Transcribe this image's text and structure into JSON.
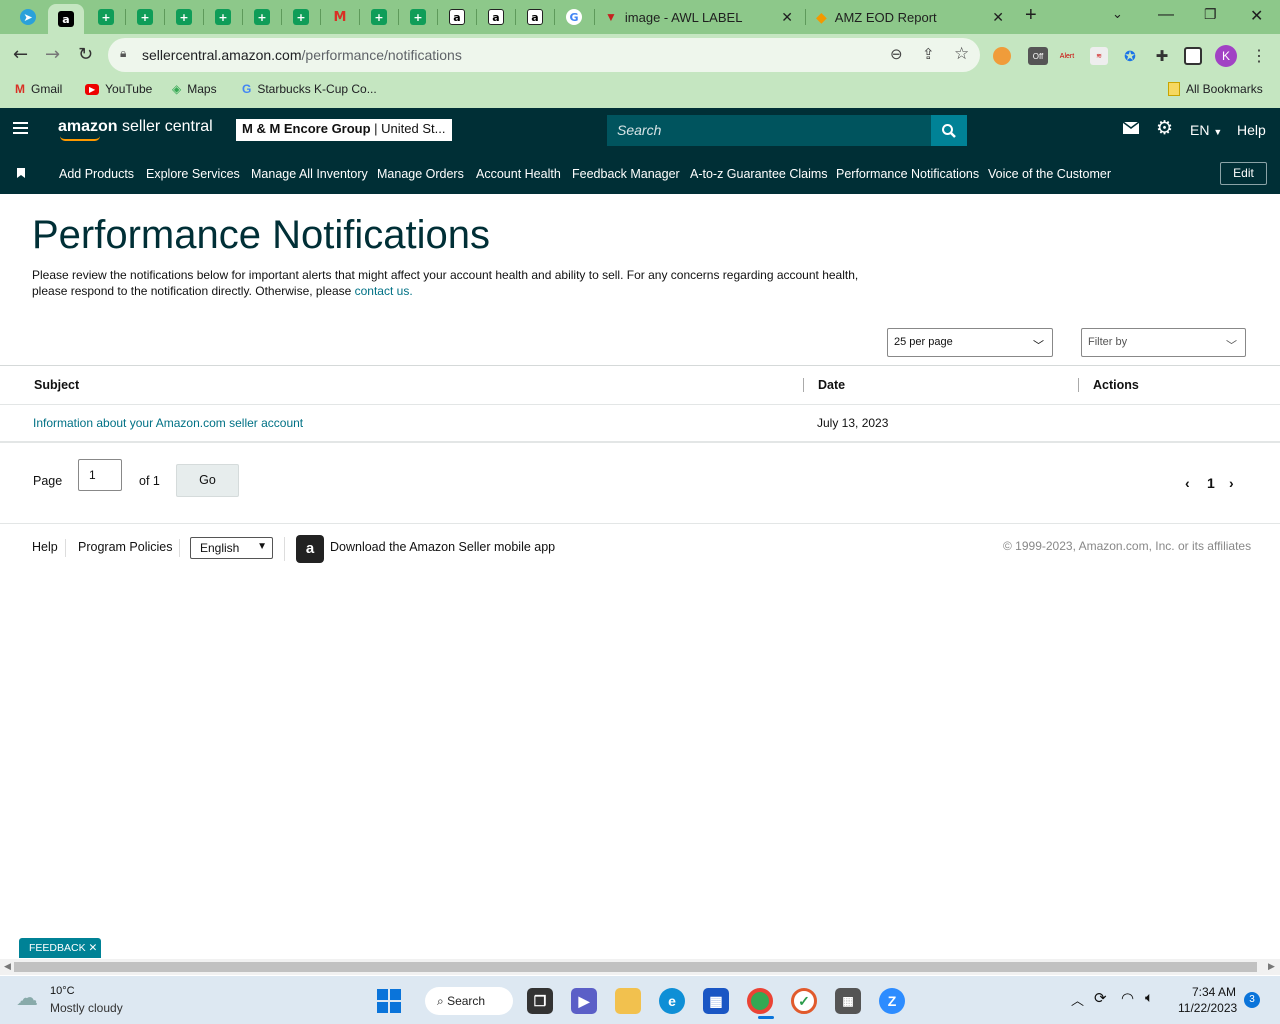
{
  "browser": {
    "tabs": [
      {
        "title": "image - AWL LABEL"
      },
      {
        "title": "AMZ EOD Report"
      }
    ],
    "url_domain": "sellercentral.amazon.com",
    "url_path": "/performance/notifications",
    "profile_initial": "K",
    "bookmarks": [
      {
        "label": "Gmail"
      },
      {
        "label": "YouTube"
      },
      {
        "label": "Maps"
      },
      {
        "label": "Starbucks K-Cup Co..."
      }
    ],
    "all_bookmarks": "All Bookmarks"
  },
  "seller": {
    "logo_prefix": "amazon",
    "logo_suffix": " seller central",
    "account_name": "M & M Encore Group",
    "account_region": " | United St...",
    "search_placeholder": "Search",
    "language": "EN",
    "help": "Help"
  },
  "nav": {
    "items": [
      "Add Products",
      "Explore Services",
      "Manage All Inventory",
      "Manage Orders",
      "Account Health",
      "Feedback Manager",
      "A-to-z Guarantee Claims",
      "Performance Notifications",
      "Voice of the Customer"
    ],
    "edit": "Edit"
  },
  "page": {
    "title": "Performance Notifications",
    "description": "Please review the notifications below for important alerts that might affect your account health and ability to sell. For any concerns regarding account health, please respond to the notification directly. Otherwise, please ",
    "contact_link": "contact us.",
    "per_page": "25 per page",
    "filter_by": "Filter by"
  },
  "table": {
    "headers": [
      "Subject",
      "Date",
      "Actions"
    ],
    "rows": [
      {
        "subject": "Information about your Amazon.com seller account",
        "date": "July 13, 2023",
        "actions": ""
      }
    ]
  },
  "pagination": {
    "page_label": "Page",
    "page_value": "1",
    "of_label": "of 1",
    "go": "Go",
    "current": "1"
  },
  "footer": {
    "help": "Help",
    "policies": "Program Policies",
    "language": "English",
    "app": "Download the Amazon Seller mobile app",
    "copyright": "© 1999-2023, Amazon.com, Inc. or its affiliates"
  },
  "feedback": "FEEDBACK",
  "taskbar": {
    "temp": "10°C",
    "weather": "Mostly cloudy",
    "search": "Search",
    "time": "7:34 AM",
    "date": "11/22/2023",
    "notifications": "3"
  },
  "colors": {
    "header_bg": "#002f36",
    "accent": "#008296",
    "link": "#007185",
    "chrome_frame": "#8dc88a"
  }
}
